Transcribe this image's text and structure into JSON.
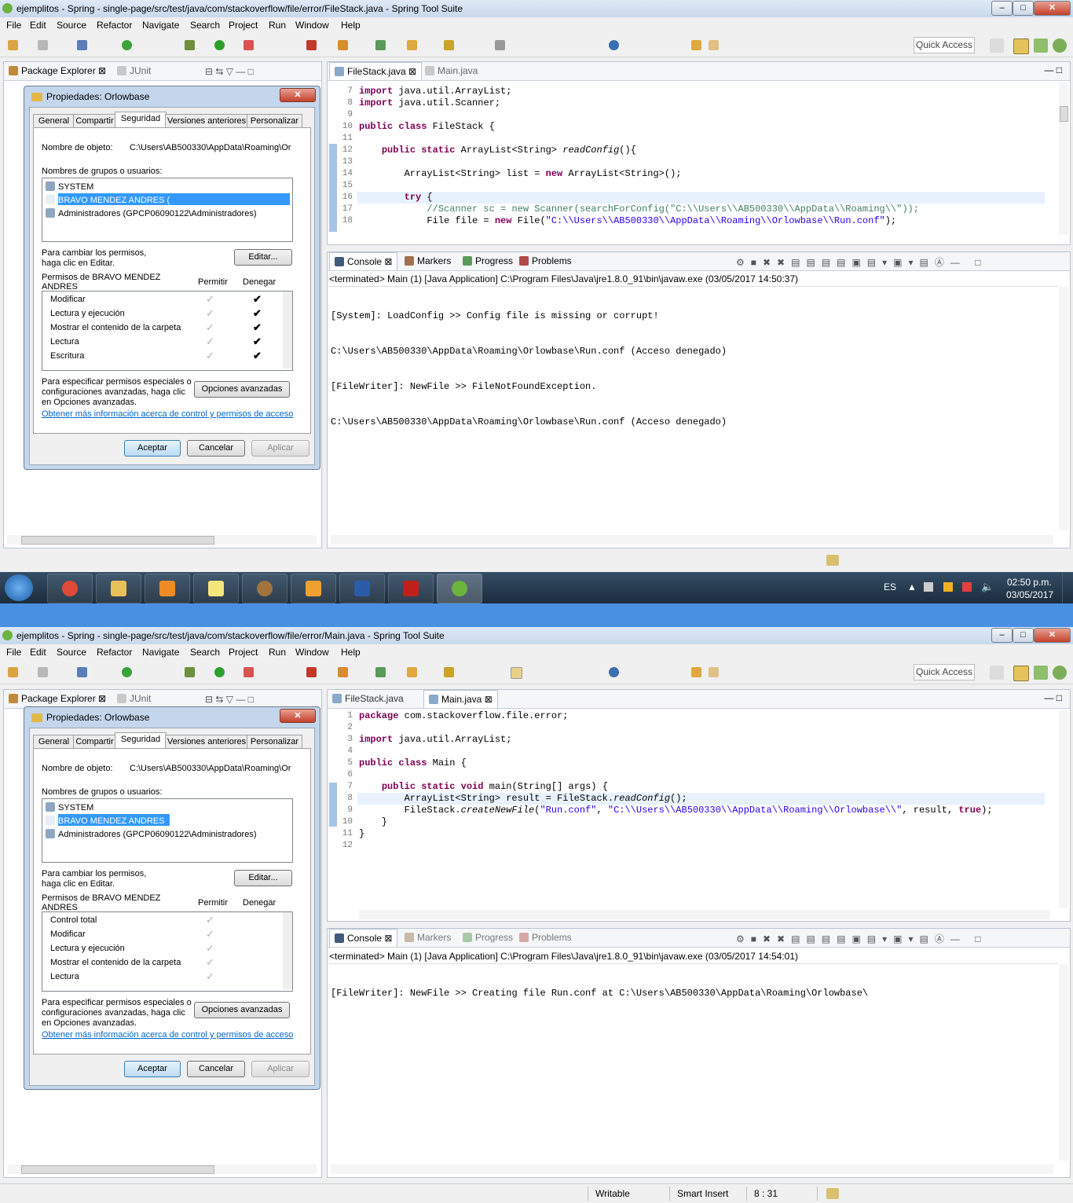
{
  "colors": {
    "accent": "#6db33f",
    "keyword": "#7f0055",
    "string": "#2a00ff",
    "comment": "#3f7f5f",
    "link": "#0066cc",
    "selection": "#3399ff"
  },
  "menu": [
    "File",
    "Edit",
    "Source",
    "Refactor",
    "Navigate",
    "Search",
    "Project",
    "Run",
    "Window",
    "Help"
  ],
  "quick_access": "Quick Access",
  "win1": {
    "title": "ejemplitos - Spring - single-page/src/test/java/com/stackoverflow/file/error/FileStack.java - Spring Tool Suite",
    "left_tabs": [
      "Package Explorer",
      "JUnit"
    ],
    "editor_tabs": [
      "FileStack.java",
      "Main.java"
    ],
    "code_lines": [
      {
        "n": "7",
        "t": "import java.util.ArrayList;"
      },
      {
        "n": "8",
        "t": "import java.util.Scanner;"
      },
      {
        "n": "9",
        "t": ""
      },
      {
        "n": "10",
        "t": "public class FileStack {"
      },
      {
        "n": "11",
        "t": ""
      },
      {
        "n": "12",
        "t": "    public static ArrayList<String> readConfig(){"
      },
      {
        "n": "13",
        "t": ""
      },
      {
        "n": "14",
        "t": "        ArrayList<String> list = new ArrayList<String>();"
      },
      {
        "n": "15",
        "t": ""
      },
      {
        "n": "16",
        "t": "        try {"
      },
      {
        "n": "17",
        "t": "            //Scanner sc = new Scanner(searchForConfig(\"C:\\\\Users\\\\AB500330\\\\AppData\\\\Roaming\\\\\"));"
      },
      {
        "n": "18",
        "t": "            File file = new File(\"C:\\\\Users\\\\AB500330\\\\AppData\\\\Roaming\\\\Orlowbase\\\\Run.conf\");"
      }
    ],
    "console_tabs": [
      "Console",
      "Markers",
      "Progress",
      "Problems"
    ],
    "console_header": "<terminated> Main (1) [Java Application] C:\\Program Files\\Java\\jre1.8.0_91\\bin\\javaw.exe (03/05/2017 14:50:37)",
    "console_lines": [
      "[System]: LoadConfig >> Config file is missing or corrupt!",
      "C:\\Users\\AB500330\\AppData\\Roaming\\Orlowbase\\Run.conf (Acceso denegado)",
      "[FileWriter]: NewFile >> FileNotFoundException.",
      "C:\\Users\\AB500330\\AppData\\Roaming\\Orlowbase\\Run.conf (Acceso denegado)"
    ],
    "dialog": {
      "title": "Propiedades: Orlowbase",
      "tabs": [
        "General",
        "Compartir",
        "Seguridad",
        "Versiones anteriores",
        "Personalizar"
      ],
      "object_label": "Nombre de objeto:",
      "object_value": "C:\\Users\\AB500330\\AppData\\Roaming\\Or",
      "groups_label": "Nombres de grupos o usuarios:",
      "users": [
        "SYSTEM",
        "BRAVO MENDEZ  ANDRES (",
        "Administradores (GPCP06090122\\Administradores)"
      ],
      "change_text_1": "Para cambiar los permisos,",
      "change_text_2": "haga clic en Editar.",
      "edit_button": "Editar...",
      "perm_label_1": "Permisos de BRAVO MENDEZ",
      "perm_label_2": "ANDRES",
      "allow_label": "Permitir",
      "deny_label": "Denegar",
      "permissions": [
        "Modificar",
        "Lectura y ejecución",
        "Mostrar el contenido de la carpeta",
        "Lectura",
        "Escritura"
      ],
      "special_1": "Para especificar permisos especiales o",
      "special_2": "configuraciones avanzadas, haga clic",
      "special_3": "en Opciones avanzadas.",
      "advanced_button": "Opciones avanzadas",
      "more_info": "Obtener más información acerca de control y permisos de acceso",
      "ok": "Aceptar",
      "cancel": "Cancelar",
      "apply": "Aplicar"
    }
  },
  "taskbar": {
    "lang": "ES",
    "time": "02:50 p.m.",
    "date": "03/05/2017"
  },
  "win2": {
    "title": "ejemplitos - Spring - single-page/src/test/java/com/stackoverflow/file/error/Main.java - Spring Tool Suite",
    "left_tabs": [
      "Package Explorer",
      "JUnit"
    ],
    "editor_tabs": [
      "FileStack.java",
      "Main.java"
    ],
    "code_lines": [
      {
        "n": "1",
        "t": "package com.stackoverflow.file.error;"
      },
      {
        "n": "2",
        "t": ""
      },
      {
        "n": "3",
        "t": "import java.util.ArrayList;"
      },
      {
        "n": "4",
        "t": ""
      },
      {
        "n": "5",
        "t": "public class Main {"
      },
      {
        "n": "6",
        "t": ""
      },
      {
        "n": "7",
        "t": "    public static void main(String[] args) {"
      },
      {
        "n": "8",
        "t": "        ArrayList<String> result = FileStack.readConfig();"
      },
      {
        "n": "9",
        "t": "        FileStack.createNewFile(\"Run.conf\", \"C:\\\\Users\\\\AB500330\\\\AppData\\\\Roaming\\\\Orlowbase\\\\\", result, true);"
      },
      {
        "n": "10",
        "t": "    }"
      },
      {
        "n": "11",
        "t": "}"
      },
      {
        "n": "12",
        "t": ""
      }
    ],
    "console_tabs": [
      "Console",
      "Markers",
      "Progress",
      "Problems"
    ],
    "console_header": "<terminated> Main (1) [Java Application] C:\\Program Files\\Java\\jre1.8.0_91\\bin\\javaw.exe (03/05/2017 14:54:01)",
    "console_lines": [
      "[FileWriter]: NewFile >> Creating file Run.conf at C:\\Users\\AB500330\\AppData\\Roaming\\Orlowbase\\"
    ],
    "dialog": {
      "title": "Propiedades: Orlowbase",
      "tabs": [
        "General",
        "Compartir",
        "Seguridad",
        "Versiones anteriores",
        "Personalizar"
      ],
      "object_label": "Nombre de objeto:",
      "object_value": "C:\\Users\\AB500330\\AppData\\Roaming\\Or",
      "groups_label": "Nombres de grupos o usuarios:",
      "users": [
        "SYSTEM",
        "BRAVO MENDEZ  ANDRES",
        "Administradores (GPCP06090122\\Administradores)"
      ],
      "change_text_1": "Para cambiar los permisos,",
      "change_text_2": "haga clic en Editar.",
      "edit_button": "Editar...",
      "perm_label_1": "Permisos de BRAVO MENDEZ",
      "perm_label_2": "ANDRES",
      "allow_label": "Permitir",
      "deny_label": "Denegar",
      "permissions": [
        "Control total",
        "Modificar",
        "Lectura y ejecución",
        "Mostrar el contenido de la carpeta",
        "Lectura"
      ],
      "special_1": "Para especificar permisos especiales o",
      "special_2": "configuraciones avanzadas, haga clic",
      "special_3": "en Opciones avanzadas.",
      "advanced_button": "Opciones avanzadas",
      "more_info": "Obtener más información acerca de control y permisos de acceso",
      "ok": "Aceptar",
      "cancel": "Cancelar",
      "apply": "Aplicar"
    },
    "status": {
      "writable": "Writable",
      "insert": "Smart Insert",
      "position": "8 : 31"
    }
  }
}
